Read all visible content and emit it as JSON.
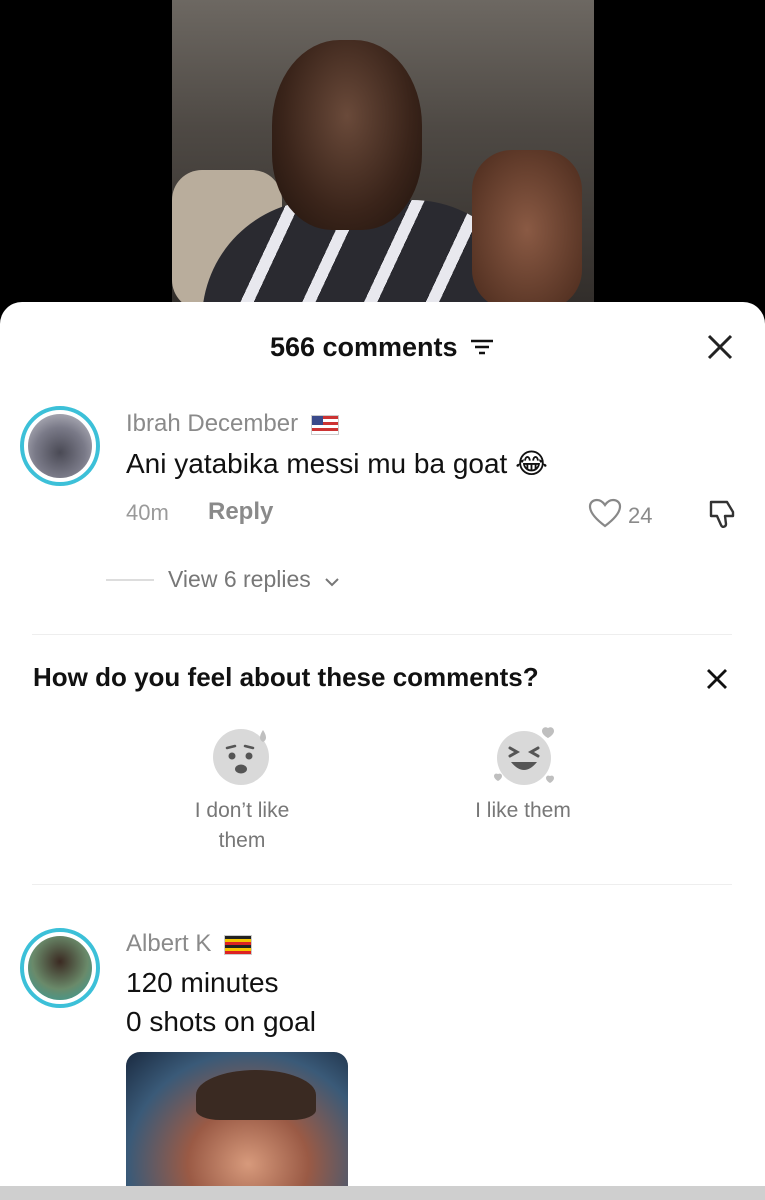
{
  "video": {
    "description_icon": "video-frame"
  },
  "sheet": {
    "comments_count": "566 comments",
    "filter_icon": "filter-icon",
    "close_icon": "close-icon"
  },
  "comments": [
    {
      "username": "Ibrah December",
      "flag": "us-flag",
      "text": "Ani yatabika messi mu ba goat 😂",
      "time": "40m",
      "reply_label": "Reply",
      "likes": "24",
      "view_replies": "View 6 replies"
    },
    {
      "username": "Albert K",
      "flag": "ug-flag",
      "text_lines": [
        "120 minutes",
        "0 shots on goal"
      ]
    }
  ],
  "feedback": {
    "title": "How do you feel about these comments?",
    "options": [
      {
        "label_line1": "I don’t like",
        "label_line2": "them",
        "icon": "sad-face-icon"
      },
      {
        "label_line1": "I like them",
        "icon": "laughing-face-icon"
      }
    ]
  },
  "colors": {
    "avatar_ring": "#3cc0d8",
    "text_muted": "#8a8a8a"
  }
}
